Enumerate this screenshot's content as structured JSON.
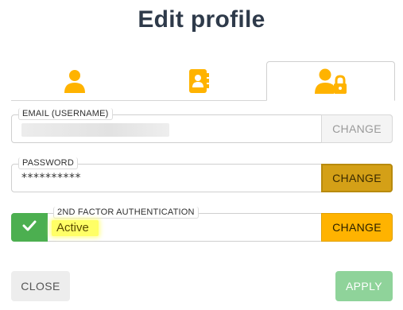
{
  "dialog": {
    "title": "Edit profile"
  },
  "tabs": [
    {
      "icon": "user-icon",
      "active": false
    },
    {
      "icon": "contact-book-icon",
      "active": false
    },
    {
      "icon": "user-lock-icon",
      "active": true
    }
  ],
  "email": {
    "label": "EMAIL (USERNAME)",
    "value_obscured": true,
    "button": "CHANGE"
  },
  "password": {
    "label": "PASSWORD",
    "value": "**********",
    "button": "CHANGE"
  },
  "two_factor": {
    "label": "2ND FACTOR AUTHENTICATION",
    "status": "Active",
    "button": "CHANGE"
  },
  "footer": {
    "close_label": "CLOSE",
    "apply_label": "APPLY"
  },
  "colors": {
    "accent": "#ffb300",
    "success": "#4caf50",
    "apply_disabled": "#8fd39a"
  }
}
